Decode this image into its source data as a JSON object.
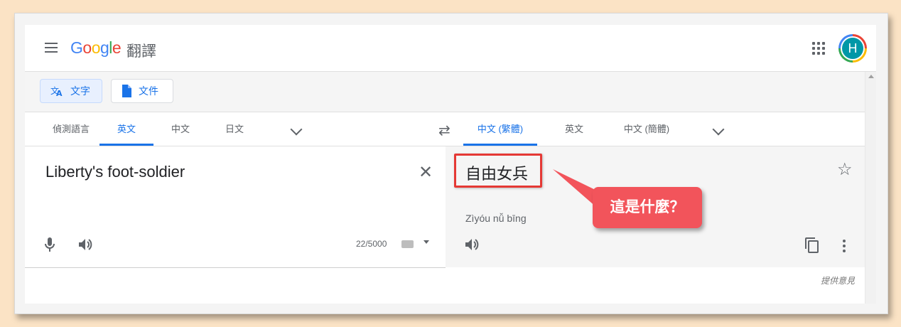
{
  "header": {
    "logo_letters": [
      {
        "ch": "G",
        "color": "#4285f4"
      },
      {
        "ch": "o",
        "color": "#ea4335"
      },
      {
        "ch": "o",
        "color": "#fbbc05"
      },
      {
        "ch": "g",
        "color": "#4285f4"
      },
      {
        "ch": "l",
        "color": "#34a853"
      },
      {
        "ch": "e",
        "color": "#ea4335"
      }
    ],
    "product_name": "翻譯",
    "avatar_initial": "H",
    "icons": [
      "menu-icon",
      "apps-icon"
    ]
  },
  "modes": {
    "text_label": "文字",
    "document_label": "文件"
  },
  "source_languages": {
    "detect": "偵測語言",
    "tabs": [
      "英文",
      "中文",
      "日文"
    ],
    "active": "英文"
  },
  "target_languages": {
    "tabs": [
      "中文 (繁體)",
      "英文",
      "中文 (簡體)"
    ],
    "active": "中文 (繁體)"
  },
  "source": {
    "text": "Liberty's foot-soldier",
    "char_count": "22/5000"
  },
  "target": {
    "text": "自由女兵",
    "romanization": "Zìyóu nǚ bīng"
  },
  "footer": {
    "feedback": "提供意見"
  },
  "annotation": {
    "callout_text": "這是什麼？",
    "highlight_color": "#e53935",
    "callout_color": "#f2545b"
  },
  "colors": {
    "accent": "#1a73e8",
    "page_background": "#fbe3c5"
  }
}
